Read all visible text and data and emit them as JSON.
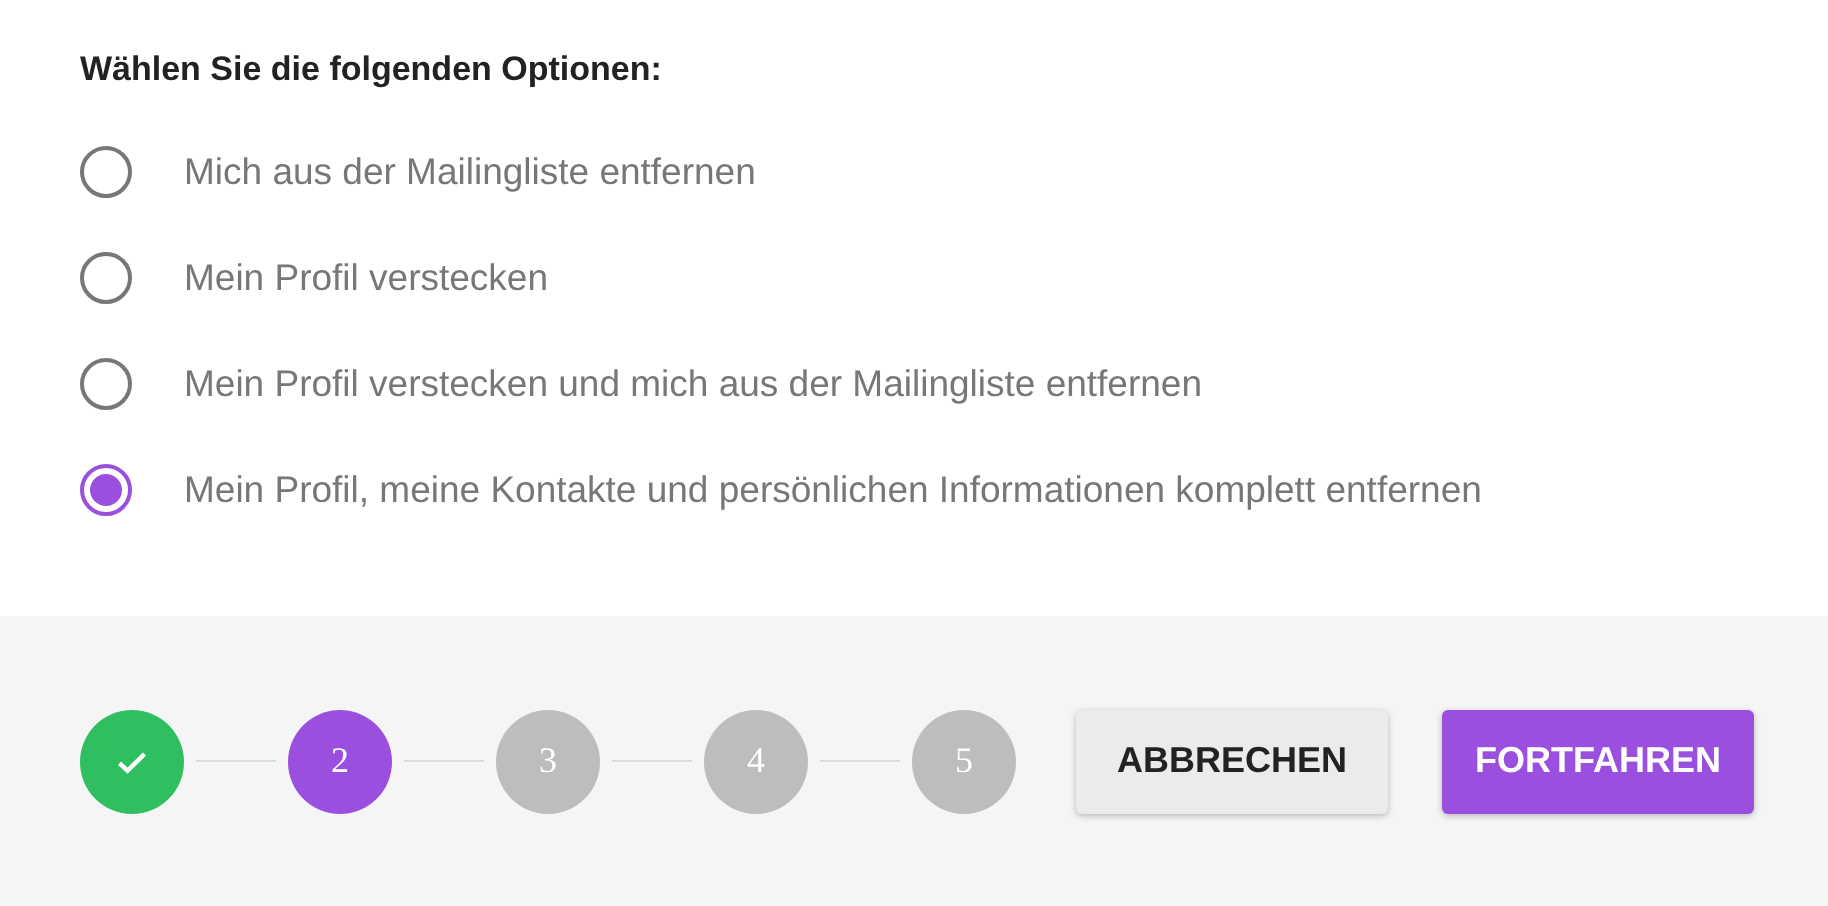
{
  "heading": "Wählen Sie die folgenden Optionen:",
  "options": [
    {
      "label": "Mich aus der Mailingliste entfernen",
      "selected": false
    },
    {
      "label": "Mein Profil verstecken",
      "selected": false
    },
    {
      "label": "Mein Profil verstecken und mich aus der Mailingliste entfernen",
      "selected": false
    },
    {
      "label": "Mein Profil, meine Kontakte und persönlichen Informationen komplett entfernen",
      "selected": true
    }
  ],
  "steps": [
    {
      "kind": "done"
    },
    {
      "label": "2",
      "kind": "active"
    },
    {
      "label": "3",
      "kind": "pending"
    },
    {
      "label": "4",
      "kind": "pending"
    },
    {
      "label": "5",
      "kind": "pending"
    }
  ],
  "buttons": [
    {
      "label": "ABBRECHEN",
      "kind": "secondary"
    },
    {
      "label": "FORTFAHREN",
      "kind": "primary"
    }
  ]
}
